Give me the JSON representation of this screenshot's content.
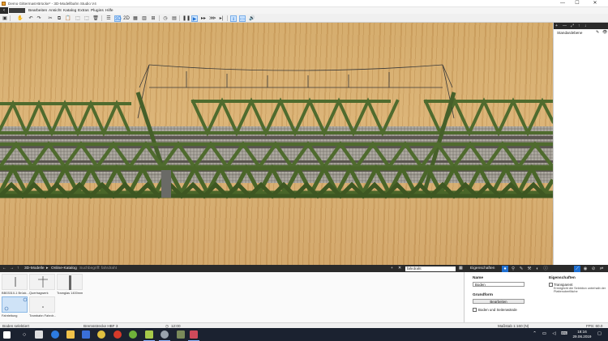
{
  "window": {
    "title": "Demo Gittermast-Brücke* - 3D-Modellbahn Studio V4",
    "buttons": {
      "minimize": "—",
      "maximize": "☐",
      "close": "✕"
    }
  },
  "menu": {
    "back_glyph": "‹",
    "items": [
      "Bearbeiten",
      "Ansicht",
      "Katalog",
      "Extras",
      "Plugins",
      "Hilfe"
    ]
  },
  "toolbar": {
    "icons": [
      "save-icon",
      "hand-icon",
      "undo-icon",
      "redo-icon",
      "cut-icon",
      "copy-icon",
      "paste-icon",
      "group-icon",
      "ungroup-icon",
      "delete-icon",
      "list-icon",
      "3d-view-icon",
      "2d-view-icon",
      "grid-icon",
      "layers-icon",
      "camera-icon",
      "clock-icon",
      "table-icon",
      "pause-icon",
      "play-icon",
      "fast-forward-icon",
      "faster-icon",
      "skip-end-icon",
      "download-icon",
      "monitor-icon",
      "volume-icon"
    ],
    "active": [
      "3d-view-icon",
      "play-icon",
      "download-icon",
      "monitor-icon"
    ]
  },
  "layers_panel": {
    "header_icons": [
      "+",
      "—",
      "⤢",
      "↑",
      "↓"
    ],
    "items": [
      {
        "label": "Standardebene"
      }
    ]
  },
  "catalog_bar": {
    "nav": [
      "←",
      "→",
      "↑"
    ],
    "breadcrumb": [
      "3D-Modelle",
      "Online-Katalog"
    ],
    "hint": "Suchbegriff: fahrdraht",
    "search_value": "fahrdraht",
    "actions": [
      "+",
      "✕"
    ]
  },
  "catalog": {
    "items": [
      {
        "label": "BB03310-1 Brück..."
      },
      {
        "label": "Quertragwerk"
      },
      {
        "label": "Tramglas 1400mm"
      },
      {
        "label": "Fahrleitung"
      },
      {
        "label": "Trambahn Fahrdr..."
      }
    ]
  },
  "properties": {
    "title": "Eigenschaften",
    "name_label": "Name",
    "name_value": "Boden",
    "shape_label": "Grundform",
    "edit_button": "Bearbeiten",
    "walls_checkbox": "Boden und Seitenwände",
    "right_title": "Eigenschaften",
    "transparent_checkbox": "Transparent",
    "transparent_desc": "Ermöglicht die Selektion unterhalb der Plattenoberfläche"
  },
  "status": {
    "selection": "Boden selektiert",
    "station": "Bremsstrecke HBF 3",
    "time": "12:00",
    "scale": "Maßstab 1:160 (N)",
    "fps": "FPS: 60.0"
  },
  "taskbar": {
    "clock_time": "18:16",
    "clock_date": "29.06.2019"
  },
  "colors": {
    "truss": "#4f6b2e",
    "truss_dark": "#34481d",
    "wood": "#d4a868",
    "accent": "#1f6fd0"
  }
}
